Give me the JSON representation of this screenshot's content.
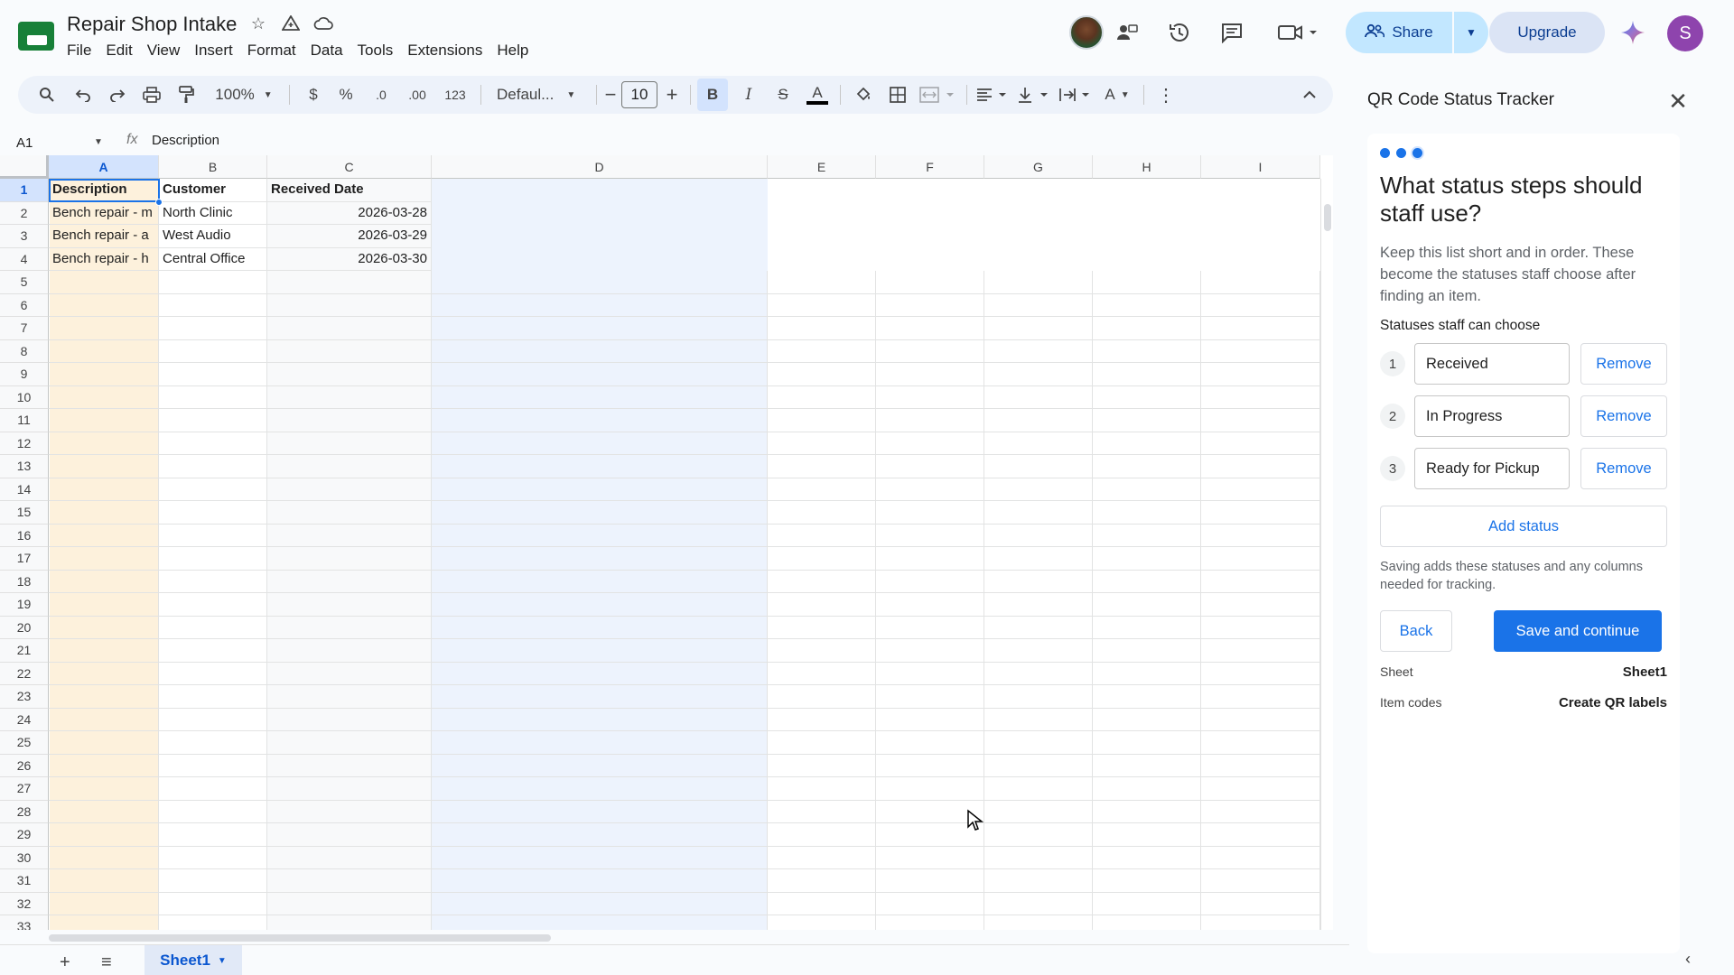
{
  "app": {
    "title": "Repair Shop Intake",
    "menu": [
      "File",
      "Edit",
      "View",
      "Insert",
      "Format",
      "Data",
      "Tools",
      "Extensions",
      "Help"
    ]
  },
  "header": {
    "share_label": "Share",
    "upgrade_label": "Upgrade",
    "user_initial": "S"
  },
  "toolbar": {
    "zoom": "100%",
    "currency": "$",
    "percent": "%",
    "decrease_decimal": ".0",
    "increase_decimal": ".00",
    "number_format": "123",
    "font": "Defaul...",
    "font_size": "10",
    "bold": "B",
    "italic": "I",
    "strike": "S",
    "text_color": "A",
    "text_rotate": "A"
  },
  "formula_bar": {
    "cell_ref": "A1",
    "fx": "fx",
    "content": "Description"
  },
  "grid": {
    "columns": [
      "A",
      "B",
      "C",
      "D",
      "E",
      "F",
      "G",
      "H",
      "I"
    ],
    "rows": [
      "1",
      "2",
      "3",
      "4",
      "5",
      "6",
      "7",
      "8",
      "9",
      "10",
      "11",
      "12",
      "13",
      "14",
      "15",
      "16",
      "17",
      "18",
      "19",
      "20",
      "21",
      "22",
      "23",
      "24",
      "25",
      "26",
      "27",
      "28",
      "29",
      "30",
      "31",
      "32",
      "33"
    ],
    "headers": [
      "Description",
      "Customer",
      "Received Date"
    ],
    "data": [
      [
        "Bench repair - m",
        "North Clinic",
        "2026-03-28"
      ],
      [
        "Bench repair - a",
        "West Audio",
        "2026-03-29"
      ],
      [
        "Bench repair - h",
        "Central Office",
        "2026-03-30"
      ]
    ]
  },
  "sheet_tab": "Sheet1",
  "panel": {
    "title": "QR Code Status Tracker",
    "question": "What status steps should staff use?",
    "description": "Keep this list short and in order. These become the statuses staff choose after finding an item.",
    "section_label": "Statuses staff can choose",
    "statuses": [
      {
        "num": "1",
        "value": "Received",
        "remove": "Remove"
      },
      {
        "num": "2",
        "value": "In Progress",
        "remove": "Remove"
      },
      {
        "num": "3",
        "value": "Ready for Pickup",
        "remove": "Remove"
      }
    ],
    "add_status": "Add status",
    "save_note": "Saving adds these statuses and any columns needed for tracking.",
    "back": "Back",
    "save": "Save and continue",
    "meta": [
      {
        "key": "Sheet",
        "value": "Sheet1"
      },
      {
        "key": "Item codes",
        "value": "Create QR labels"
      }
    ]
  },
  "colors": {
    "accent": "#1a73e8",
    "share_bg": "#c2e7ff",
    "sheets_green": "#188038",
    "col_a_highlight": "#fdf1dc",
    "col_d_highlight": "#edf3fd"
  }
}
